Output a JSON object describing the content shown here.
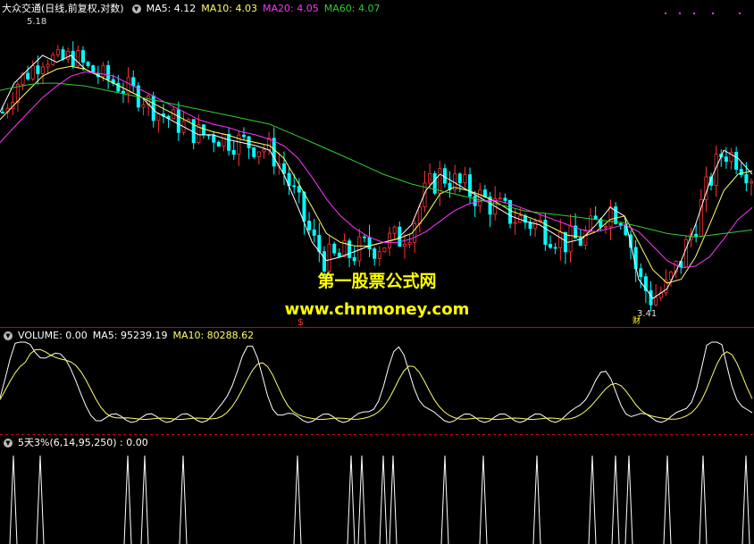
{
  "price_panel": {
    "title": "大众交通(日线,前复权,对数)",
    "ma5": "MA5: 4.12",
    "ma10": "MA10: 4.03",
    "ma20": "MA20: 4.05",
    "ma60": "MA60: 4.07",
    "high_label": "5.18",
    "low_label": "3.41",
    "signal_mark": "$",
    "low_mark": "财"
  },
  "volume_panel": {
    "title": "VOLUME: 0.00",
    "ma5": "MA5: 95239.19",
    "ma10": "MA10: 80288.62"
  },
  "indicator_panel": {
    "title": "5天3%(6,14,95,250) : 0.00"
  },
  "watermark": {
    "line1": "第一股票公式网",
    "line2": "www.chnmoney.com"
  },
  "colors": {
    "up": "#ff3333",
    "down": "#00ffff",
    "ma5": "#ffffff",
    "ma10": "#ffff66",
    "ma20": "#ff33ff",
    "ma60": "#33cc33",
    "divider": "#cc0000",
    "watermark": "#ffff00"
  },
  "chart_data": {
    "type": "line",
    "series": [
      {
        "name": "MA5",
        "values": [
          4.6,
          4.8,
          4.9,
          5.0,
          4.95,
          5.0,
          4.9,
          4.85,
          4.8,
          4.75,
          4.7,
          4.6,
          4.55,
          4.5,
          4.45,
          4.45,
          4.42,
          4.4,
          4.38,
          4.35,
          4.2,
          4.0,
          3.8,
          3.7,
          3.72,
          3.75,
          3.78,
          3.8,
          3.82,
          3.9,
          4.1,
          4.2,
          4.15,
          4.1,
          4.05,
          4.0,
          3.95,
          3.92,
          3.9,
          3.85,
          3.8,
          3.82,
          3.9,
          4.0,
          3.95,
          3.6,
          3.5,
          3.55,
          3.7,
          3.9,
          4.15,
          4.35,
          4.3,
          4.2
        ]
      },
      {
        "name": "MA10",
        "values": [
          4.55,
          4.65,
          4.75,
          4.85,
          4.9,
          4.92,
          4.9,
          4.85,
          4.8,
          4.75,
          4.7,
          4.65,
          4.6,
          4.55,
          4.5,
          4.47,
          4.45,
          4.42,
          4.4,
          4.38,
          4.3,
          4.15,
          4.0,
          3.85,
          3.8,
          3.78,
          3.78,
          3.8,
          3.82,
          3.85,
          3.95,
          4.08,
          4.12,
          4.1,
          4.07,
          4.03,
          3.98,
          3.95,
          3.92,
          3.88,
          3.84,
          3.83,
          3.86,
          3.93,
          3.95,
          3.8,
          3.65,
          3.58,
          3.6,
          3.72,
          3.9,
          4.1,
          4.2,
          4.22
        ]
      },
      {
        "name": "MA20",
        "values": [
          4.4,
          4.5,
          4.6,
          4.7,
          4.78,
          4.85,
          4.88,
          4.87,
          4.85,
          4.8,
          4.75,
          4.7,
          4.65,
          4.6,
          4.55,
          4.52,
          4.5,
          4.47,
          4.45,
          4.42,
          4.38,
          4.3,
          4.18,
          4.05,
          3.95,
          3.88,
          3.83,
          3.8,
          3.8,
          3.82,
          3.86,
          3.92,
          3.98,
          4.02,
          4.04,
          4.04,
          4.02,
          3.99,
          3.96,
          3.93,
          3.9,
          3.87,
          3.86,
          3.88,
          3.9,
          3.86,
          3.78,
          3.7,
          3.66,
          3.67,
          3.72,
          3.82,
          3.93,
          4.0
        ]
      },
      {
        "name": "MA60",
        "values": [
          4.75,
          4.77,
          4.79,
          4.8,
          4.8,
          4.79,
          4.78,
          4.76,
          4.74,
          4.72,
          4.7,
          4.68,
          4.66,
          4.64,
          4.62,
          4.6,
          4.58,
          4.56,
          4.54,
          4.52,
          4.48,
          4.44,
          4.4,
          4.36,
          4.32,
          4.28,
          4.24,
          4.2,
          4.17,
          4.14,
          4.12,
          4.1,
          4.08,
          4.06,
          4.04,
          4.02,
          4.0,
          3.98,
          3.97,
          3.96,
          3.95,
          3.94,
          3.93,
          3.92,
          3.91,
          3.89,
          3.87,
          3.85,
          3.84,
          3.83,
          3.84,
          3.85,
          3.86,
          3.87
        ]
      }
    ],
    "ylim": [
      3.41,
      5.18
    ]
  }
}
